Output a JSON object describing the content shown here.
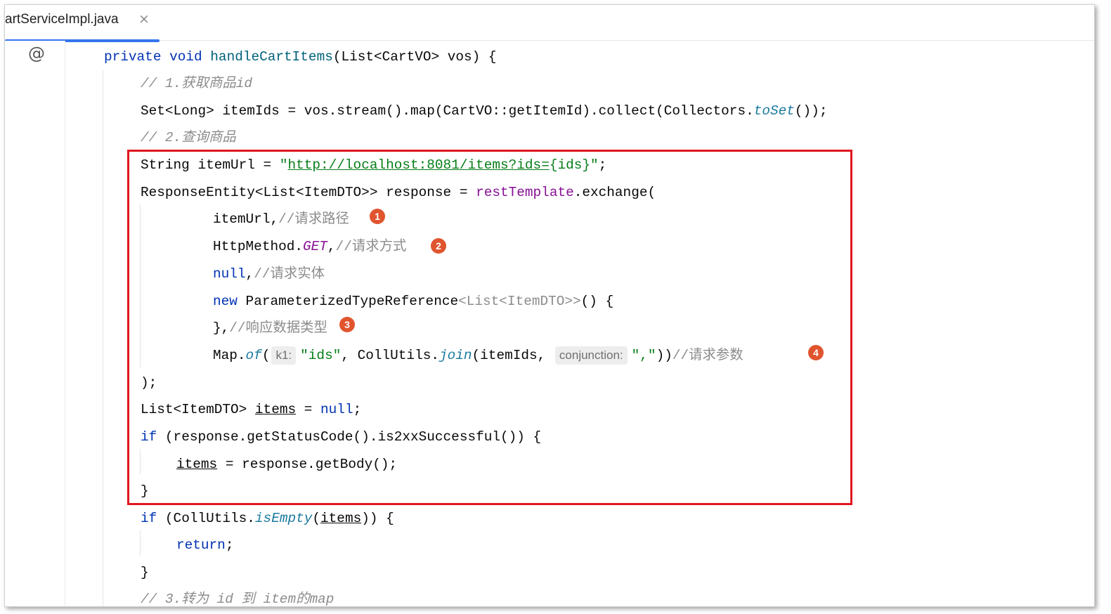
{
  "tab": {
    "label": "artServiceImpl.java",
    "close_label": "×"
  },
  "gutter": {
    "icon": "@"
  },
  "lines": {
    "l1": {
      "kw1": "private",
      "kw2": "void",
      "method": "handleCartItems",
      "rest": "(List<CartVO> vos) {"
    },
    "l2": {
      "text": "// 1.获取商品",
      "ital": "id"
    },
    "l3": {
      "p1": "Set<Long> itemIds = vos.stream().map(CartVO::getItemId).collect(Collectors.",
      "stat": "toSet",
      "p2": "());"
    },
    "l4": {
      "text": "// 2.查询商品"
    },
    "l5": {
      "p1": "String itemUrl = ",
      "q1": "\"",
      "url": "http://localhost:8081/items?ids=",
      "tail": "{ids}",
      "q2": "\"",
      "p2": ";"
    },
    "l6": {
      "p1": "ResponseEntity<List<ItemDTO>> response = ",
      "field": "restTemplate",
      "p2": ".exchange("
    },
    "l7": {
      "p1": "itemUrl,",
      "cmt": "//请求路径"
    },
    "l8": {
      "p1": "HttpMethod.",
      "enm": "GET",
      "p2": ",",
      "cmt": "//请求方式"
    },
    "l9": {
      "kw": "null",
      "p1": ",",
      "cmt": "//请求实体"
    },
    "l10": {
      "kw": "new",
      "p1": " ParameterizedTypeReference",
      "gen": "<List<ItemDTO>>",
      "p2": "() {"
    },
    "l11": {
      "p1": "},",
      "cmt": "//响应数据类型"
    },
    "l12": {
      "p1": "Map.",
      "stat1": "of",
      "p2": "(",
      "hint1": "k1:",
      "str1": "\"ids\"",
      "p3": ", CollUtils.",
      "stat2": "join",
      "p4": "(itemIds,",
      "hint2": "conjunction:",
      "str2": "\",\"",
      "p5": "))",
      "cmt": "//请求参数"
    },
    "l13": {
      "text": ");"
    },
    "l14": {
      "p1": "List<ItemDTO> ",
      "var": "items",
      "p2": " = ",
      "kw": "null",
      "p3": ";"
    },
    "l15": {
      "kw": "if",
      "p1": " (response.getStatusCode().is2xxSuccessful()) {"
    },
    "l16": {
      "var": "items",
      "p1": " = response.getBody();"
    },
    "l17": {
      "text": "}"
    },
    "l18": {
      "kw": "if",
      "p1": " (CollUtils.",
      "stat": "isEmpty",
      "p2": "(",
      "var": "items",
      "p3": ")) {"
    },
    "l19": {
      "kw": "return",
      "p1": ";"
    },
    "l20": {
      "text": "}"
    },
    "l21": {
      "text": "// 3.转为 id 到 item的map"
    }
  },
  "badges": [
    "1",
    "2",
    "3",
    "4"
  ],
  "colors": {
    "highlight": "#e0161f",
    "badge": "#e0542e",
    "tab_underline": "#3574f0"
  }
}
